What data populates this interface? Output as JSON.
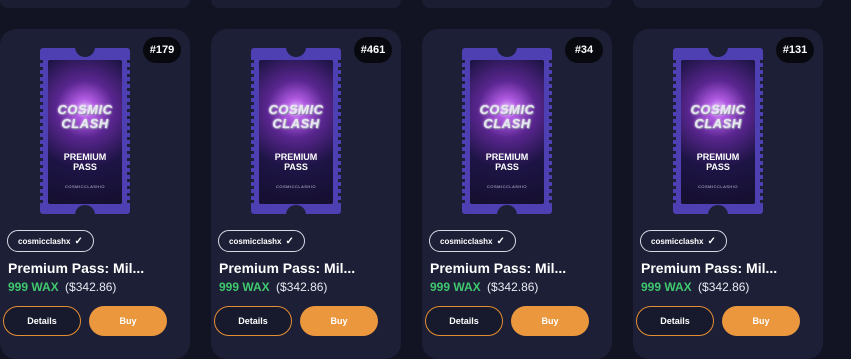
{
  "cards": [
    {
      "number": "#179",
      "ticket": {
        "line1": "COSMIC",
        "line2": "CLASH",
        "pass_line1": "PREMIUM",
        "pass_line2": "PASS",
        "small": "COSMICCLASHIO"
      },
      "collection": "cosmicclashx",
      "title": "Premium Pass: Mil...",
      "price_wax": "999 WAX",
      "price_usd": "($342.86)",
      "details_label": "Details",
      "buy_label": "Buy"
    },
    {
      "number": "#461",
      "ticket": {
        "line1": "COSMIC",
        "line2": "CLASH",
        "pass_line1": "PREMIUM",
        "pass_line2": "PASS",
        "small": "COSMICCLASHIO"
      },
      "collection": "cosmicclashx",
      "title": "Premium Pass: Mil...",
      "price_wax": "999 WAX",
      "price_usd": "($342.86)",
      "details_label": "Details",
      "buy_label": "Buy"
    },
    {
      "number": "#34",
      "ticket": {
        "line1": "COSMIC",
        "line2": "CLASH",
        "pass_line1": "PREMIUM",
        "pass_line2": "PASS",
        "small": "COSMICCLASHIO"
      },
      "collection": "cosmicclashx",
      "title": "Premium Pass: Mil...",
      "price_wax": "999 WAX",
      "price_usd": "($342.86)",
      "details_label": "Details",
      "buy_label": "Buy"
    },
    {
      "number": "#131",
      "ticket": {
        "line1": "COSMIC",
        "line2": "CLASH",
        "pass_line1": "PREMIUM",
        "pass_line2": "PASS",
        "small": "COSMICCLASHIO"
      },
      "collection": "cosmicclashx",
      "title": "Premium Pass: Mil...",
      "price_wax": "999 WAX",
      "price_usd": "($342.86)",
      "details_label": "Details",
      "buy_label": "Buy"
    }
  ],
  "icons": {
    "verified": "checkmark-icon"
  },
  "colors": {
    "accent": "#eb973d",
    "wax": "#3fc86f",
    "card_bg": "#1c1f35",
    "page_bg": "#121424"
  }
}
